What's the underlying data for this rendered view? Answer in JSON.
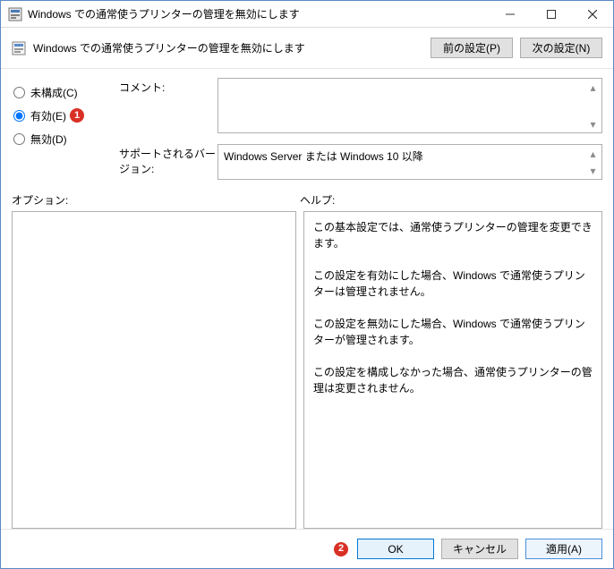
{
  "window": {
    "title": "Windows での通常使うプリンターの管理を無効にします"
  },
  "header": {
    "policy_title": "Windows での通常使うプリンターの管理を無効にします",
    "prev_btn": "前の設定(P)",
    "next_btn": "次の設定(N)"
  },
  "radios": {
    "not_configured": "未構成(C)",
    "enabled": "有効(E)",
    "disabled": "無効(D)",
    "selected": "enabled"
  },
  "annotations": {
    "badge1": "1",
    "badge2": "2"
  },
  "labels": {
    "comment": "コメント:",
    "supported": "サポートされるバージョン:",
    "options": "オプション:",
    "help": "ヘルプ:"
  },
  "fields": {
    "comment": "",
    "supported": "Windows Server または Windows 10 以降"
  },
  "help_text": "この基本設定では、通常使うプリンターの管理を変更できます。\n\nこの設定を有効にした場合、Windows で通常使うプリンターは管理されません。\n\nこの設定を無効にした場合、Windows で通常使うプリンターが管理されます。\n\nこの設定を構成しなかった場合、通常使うプリンターの管理は変更されません。",
  "buttons": {
    "ok": "OK",
    "cancel": "キャンセル",
    "apply": "適用(A)"
  }
}
